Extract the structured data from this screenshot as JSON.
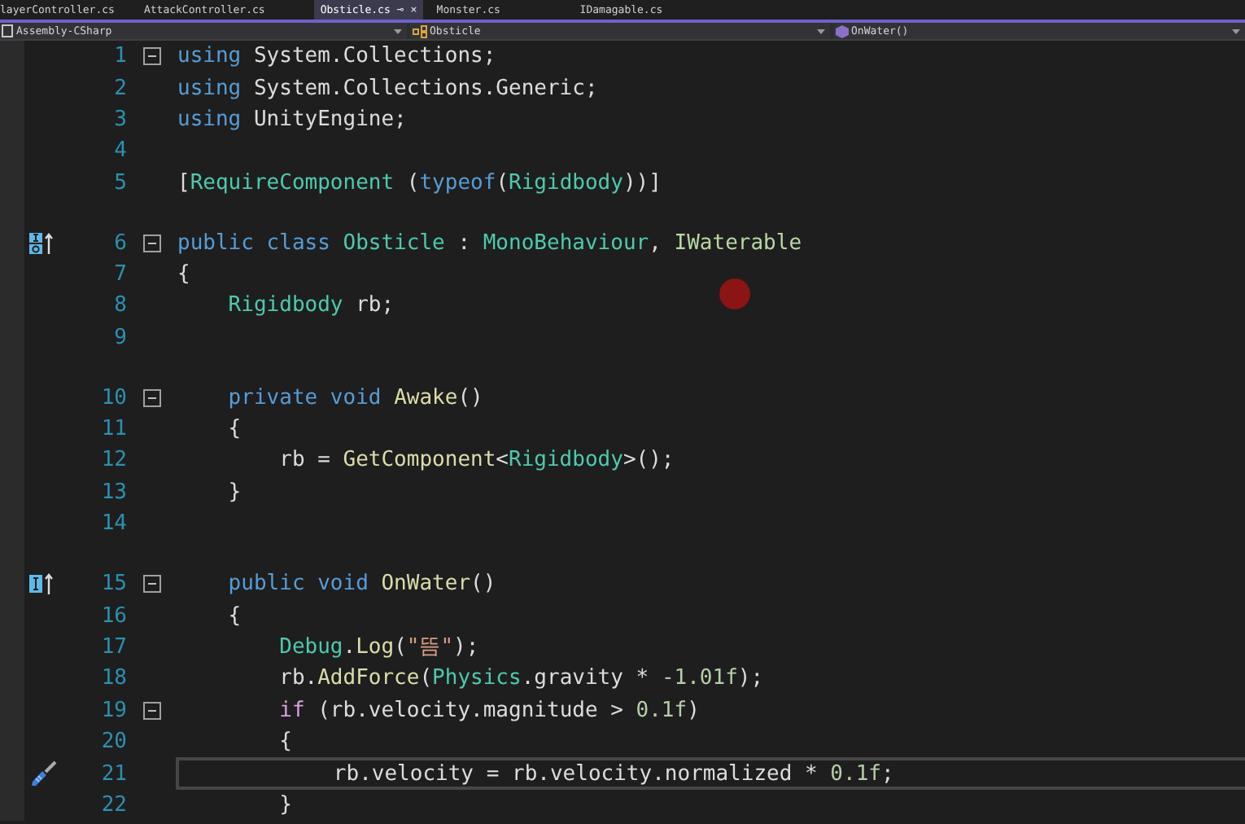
{
  "tabs": [
    {
      "label": "layerController.cs",
      "selected": false
    },
    {
      "label": "AttackController.cs",
      "selected": false
    },
    {
      "label": "Obsticle.cs",
      "selected": true,
      "pin": "⊸",
      "close": "×"
    },
    {
      "label": "Monster.cs",
      "selected": false
    },
    {
      "label": "IDamagable.cs",
      "selected": false
    }
  ],
  "navigation": [
    {
      "label": "Assembly-CSharp",
      "kind": "project"
    },
    {
      "label": "Obsticle",
      "kind": "class"
    },
    {
      "label": "OnWater()",
      "kind": "method"
    }
  ],
  "lines": [
    {
      "kind": "code",
      "number": "1",
      "fold": true,
      "tokens": [
        {
          "kind": "keyword",
          "text": "using"
        },
        {
          "kind": "plain",
          "text": " System.Collections;"
        }
      ]
    },
    {
      "kind": "code",
      "number": "2",
      "tokens": [
        {
          "kind": "keyword",
          "text": "using"
        },
        {
          "kind": "plain",
          "text": " System.Collections.Generic;"
        }
      ]
    },
    {
      "kind": "code",
      "number": "3",
      "tokens": [
        {
          "kind": "keyword",
          "text": "using"
        },
        {
          "kind": "plain",
          "text": " UnityEngine;"
        }
      ]
    },
    {
      "kind": "code",
      "number": "4"
    },
    {
      "kind": "code",
      "number": "5",
      "tokens": [
        {
          "kind": "plain",
          "text": "["
        },
        {
          "kind": "type",
          "text": "RequireComponent"
        },
        {
          "kind": "plain",
          "text": " ("
        },
        {
          "kind": "keyword",
          "text": "typeof"
        },
        {
          "kind": "plain",
          "text": "("
        },
        {
          "kind": "type",
          "text": "Rigidbody"
        },
        {
          "kind": "plain",
          "text": "))]"
        }
      ]
    },
    {
      "kind": "spacer"
    },
    {
      "kind": "code",
      "number": "6",
      "fold": true,
      "gutter": {
        "kind": "implements-class"
      },
      "tokens": [
        {
          "kind": "keyword",
          "text": "public class "
        },
        {
          "kind": "type",
          "text": "Obsticle"
        },
        {
          "kind": "plain",
          "text": " : "
        },
        {
          "kind": "type",
          "text": "MonoBehaviour"
        },
        {
          "kind": "plain",
          "text": ", "
        },
        {
          "kind": "interface",
          "text": "IWaterable"
        }
      ]
    },
    {
      "kind": "code",
      "number": "7",
      "tokens": [
        {
          "kind": "plain",
          "text": "{"
        }
      ]
    },
    {
      "kind": "code",
      "number": "8",
      "tokens": [
        {
          "kind": "type",
          "text": "    Rigidbody"
        },
        {
          "kind": "plain",
          "text": " rb;"
        }
      ]
    },
    {
      "kind": "code",
      "number": "9"
    },
    {
      "kind": "spacer"
    },
    {
      "kind": "code",
      "number": "10",
      "fold": true,
      "tokens": [
        {
          "kind": "keyword",
          "text": "    private void "
        },
        {
          "kind": "method",
          "text": "Awake"
        },
        {
          "kind": "plain",
          "text": "()"
        }
      ]
    },
    {
      "kind": "code",
      "number": "11",
      "tokens": [
        {
          "kind": "plain",
          "text": "    {"
        }
      ]
    },
    {
      "kind": "code",
      "number": "12",
      "tokens": [
        {
          "kind": "plain",
          "text": "        rb = "
        },
        {
          "kind": "method",
          "text": "GetComponent"
        },
        {
          "kind": "plain",
          "text": "<"
        },
        {
          "kind": "type",
          "text": "Rigidbody"
        },
        {
          "kind": "plain",
          "text": ">();"
        }
      ]
    },
    {
      "kind": "code",
      "number": "13",
      "tokens": [
        {
          "kind": "plain",
          "text": "    }"
        }
      ]
    },
    {
      "kind": "code",
      "number": "14"
    },
    {
      "kind": "spacer"
    },
    {
      "kind": "code",
      "number": "15",
      "fold": true,
      "gutter": {
        "kind": "implements-member"
      },
      "tokens": [
        {
          "kind": "keyword",
          "text": "    public void "
        },
        {
          "kind": "method",
          "text": "OnWater"
        },
        {
          "kind": "plain",
          "text": "()"
        }
      ]
    },
    {
      "kind": "code",
      "number": "16",
      "tokens": [
        {
          "kind": "plain",
          "text": "    {"
        }
      ]
    },
    {
      "kind": "code",
      "number": "17",
      "tokens": [
        {
          "kind": "type",
          "text": "        Debug"
        },
        {
          "kind": "plain",
          "text": "."
        },
        {
          "kind": "method",
          "text": "Log"
        },
        {
          "kind": "plain",
          "text": "("
        },
        {
          "kind": "string",
          "text": "\"뜸\""
        },
        {
          "kind": "plain",
          "text": ");"
        }
      ]
    },
    {
      "kind": "code",
      "number": "18",
      "tokens": [
        {
          "kind": "plain",
          "text": "        rb."
        },
        {
          "kind": "method",
          "text": "AddForce"
        },
        {
          "kind": "plain",
          "text": "("
        },
        {
          "kind": "type",
          "text": "Physics"
        },
        {
          "kind": "plain",
          "text": ".gravity * "
        },
        {
          "kind": "number",
          "text": "-1.01f"
        },
        {
          "kind": "plain",
          "text": ");"
        }
      ]
    },
    {
      "kind": "code",
      "number": "19",
      "fold": true,
      "tokens": [
        {
          "kind": "control",
          "text": "        if"
        },
        {
          "kind": "plain",
          "text": " (rb.velocity.magnitude > "
        },
        {
          "kind": "number",
          "text": "0.1f"
        },
        {
          "kind": "plain",
          "text": ")"
        }
      ]
    },
    {
      "kind": "code",
      "number": "20",
      "tokens": [
        {
          "kind": "plain",
          "text": "        {"
        }
      ]
    },
    {
      "kind": "code",
      "number": "21",
      "current": true,
      "gutter": {
        "kind": "quick-action"
      },
      "tokens": [
        {
          "kind": "plain",
          "text": "            rb.velocity = rb.velocity.normalized * "
        },
        {
          "kind": "number",
          "text": "0.1f"
        },
        {
          "kind": "plain",
          "text": ";"
        }
      ]
    },
    {
      "kind": "code",
      "number": "22",
      "tokens": [
        {
          "kind": "plain",
          "text": "        }"
        }
      ]
    }
  ]
}
